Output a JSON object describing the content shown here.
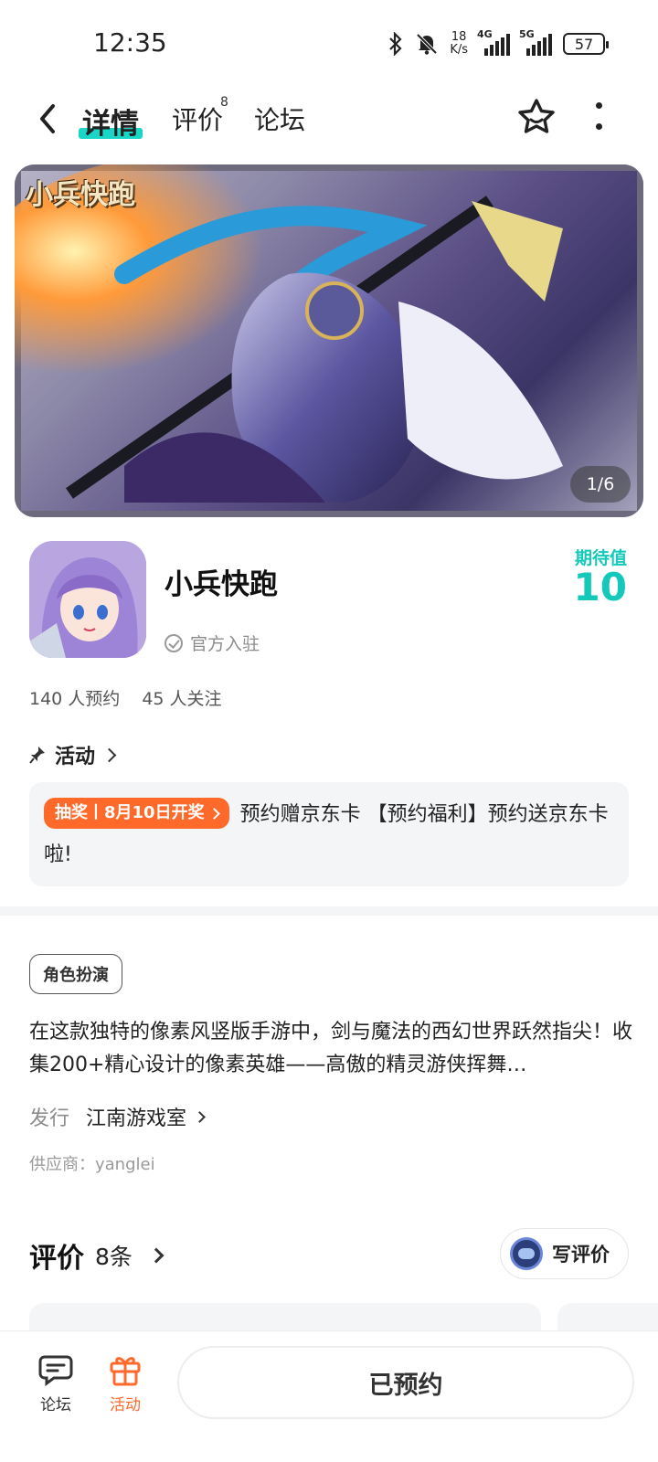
{
  "status_bar": {
    "time": "12:35",
    "net_speed_value": "18",
    "net_speed_unit": "K/s",
    "signal1_label": "4G",
    "signal2_label": "5G",
    "battery": "57"
  },
  "nav": {
    "tabs": [
      {
        "label": "详情",
        "active": true
      },
      {
        "label": "评价",
        "badge": "8"
      },
      {
        "label": "论坛"
      }
    ]
  },
  "banner": {
    "logo_text": "小兵快跑",
    "counter": "1/6"
  },
  "app": {
    "name": "小兵快跑",
    "official_label": "官方入驻",
    "expect_label": "期待值",
    "expect_value": "10",
    "reservations": "140 人预约",
    "followers": "45 人关注"
  },
  "activity": {
    "title": "活动",
    "badge": "抽奖丨8月10日开奖",
    "text": "预约赠京东卡 【预约福利】预约送京东卡啦!"
  },
  "details": {
    "genre": "角色扮演",
    "description": "在这款独特的像素风竖版手游中，剑与魔法的西幻世界跃然指尖！收集200+精心设计的像素英雄——高傲的精灵游侠挥舞…",
    "publisher_label": "发行",
    "publisher_value": "江南游戏室",
    "supplier": "供应商：yanglei"
  },
  "reviews": {
    "title": "评价",
    "count": "8条",
    "write_label": "写评价"
  },
  "bottom_bar": {
    "forum_label": "论坛",
    "activity_label": "活动",
    "reserve_label": "已预约"
  },
  "colors": {
    "accent_teal": "#14c9b9",
    "accent_orange": "#ff6a2b"
  }
}
